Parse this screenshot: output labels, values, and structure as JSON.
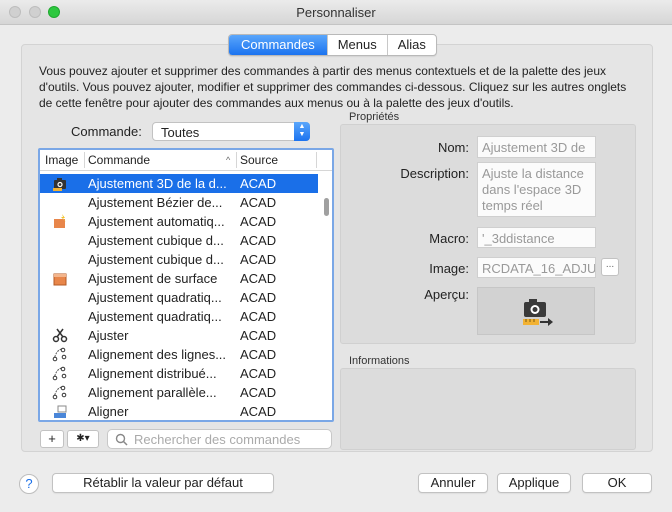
{
  "window": {
    "title": "Personnaliser"
  },
  "tabs": [
    {
      "label": "Commandes",
      "active": true
    },
    {
      "label": "Menus",
      "active": false
    },
    {
      "label": "Alias",
      "active": false
    }
  ],
  "description": "Vous pouvez ajouter et supprimer des commandes à partir des menus contextuels et de la palette des jeux d'outils. Vous pouvez ajouter, modifier et supprimer des commandes ci-dessous. Cliquez sur les autres onglets de cette fenêtre pour ajouter des commandes aux menus ou à la palette des jeux d'outils.",
  "filter": {
    "label": "Commande:",
    "value": "Toutes"
  },
  "list": {
    "columns": {
      "image": "Image",
      "command": "Commande",
      "source": "Source",
      "sort_glyph": "^"
    },
    "rows": [
      {
        "name": "Ajustement 3D de la d...",
        "source": "ACAD",
        "icon": "camera-icon",
        "selected": true
      },
      {
        "name": "Ajustement Bézier de...",
        "source": "ACAD",
        "icon": "",
        "selected": false
      },
      {
        "name": "Ajustement automatiq...",
        "source": "ACAD",
        "icon": "auto-fit-icon",
        "selected": false
      },
      {
        "name": "Ajustement cubique d...",
        "source": "ACAD",
        "icon": "",
        "selected": false
      },
      {
        "name": "Ajustement cubique d...",
        "source": "ACAD",
        "icon": "",
        "selected": false
      },
      {
        "name": "Ajustement de surface",
        "source": "ACAD",
        "icon": "surface-icon",
        "selected": false
      },
      {
        "name": "Ajustement quadratiq...",
        "source": "ACAD",
        "icon": "",
        "selected": false
      },
      {
        "name": "Ajustement quadratiq...",
        "source": "ACAD",
        "icon": "",
        "selected": false
      },
      {
        "name": "Ajuster",
        "source": "ACAD",
        "icon": "scissors-icon",
        "selected": false
      },
      {
        "name": "Alignement des lignes...",
        "source": "ACAD",
        "icon": "align-lines-icon",
        "selected": false
      },
      {
        "name": "Alignement distribué...",
        "source": "ACAD",
        "icon": "align-distribute-icon",
        "selected": false
      },
      {
        "name": "Alignement parallèle...",
        "source": "ACAD",
        "icon": "align-parallel-icon",
        "selected": false
      },
      {
        "name": "Aligner",
        "source": "ACAD",
        "icon": "align-icon",
        "selected": false
      }
    ]
  },
  "toolbar": {
    "add_label": "+",
    "gear_glyph": "✱▾"
  },
  "search": {
    "placeholder": "Rechercher des commandes"
  },
  "properties": {
    "section_label": "Propriétés",
    "name_label": "Nom:",
    "name_value": "Ajustement 3D de",
    "description_label": "Description:",
    "description_value": "Ajuste la distance dans l'espace 3D temps réel",
    "macro_label": "Macro:",
    "macro_value": "'_3ddistance",
    "image_label": "Image:",
    "image_value": "RCDATA_16_ADJUS",
    "image_browse": "...",
    "preview_label": "Aperçu:"
  },
  "info": {
    "section_label": "Informations"
  },
  "footer": {
    "help_label": "?",
    "reset_label": "Rétablir la valeur par défaut",
    "cancel_label": "Annuler",
    "apply_label": "Applique",
    "ok_label": "OK"
  },
  "colors": {
    "accent": "#1a6fe8",
    "zoom_green": "#2dc83f"
  }
}
